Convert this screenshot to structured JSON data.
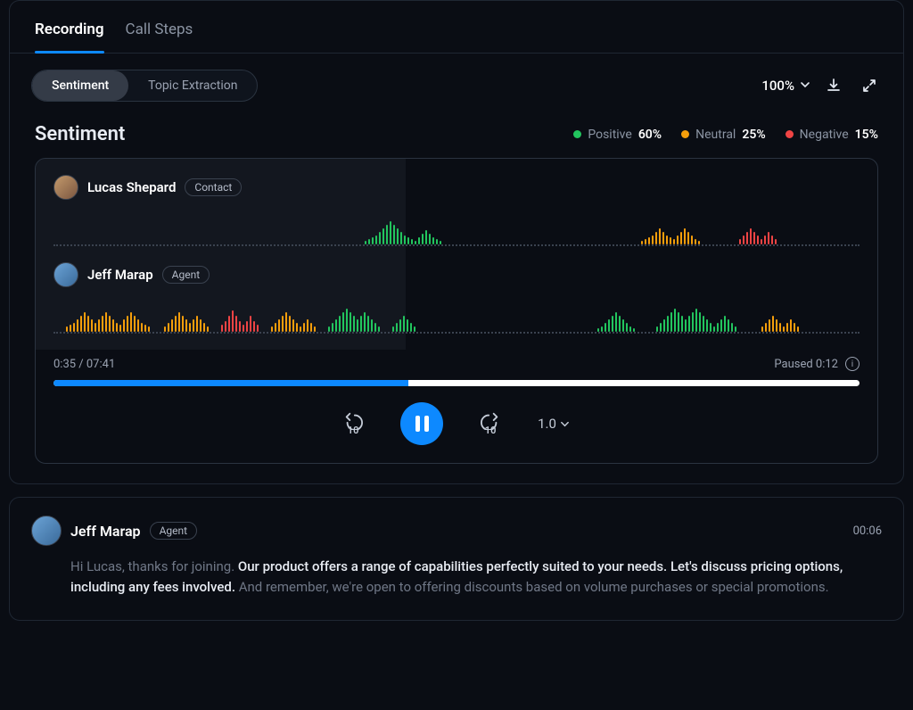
{
  "tabs": {
    "recording": "Recording",
    "call_steps": "Call Steps"
  },
  "toolbar": {
    "sentiment": "Sentiment",
    "topic_extraction": "Topic Extraction",
    "zoom": "100%"
  },
  "section": {
    "title": "Sentiment",
    "legend": {
      "positive_label": "Positive",
      "positive_val": "60%",
      "neutral_label": "Neutral",
      "neutral_val": "25%",
      "negative_label": "Negative",
      "negative_val": "15%"
    }
  },
  "colors": {
    "positive": "#22c55e",
    "neutral": "#f59e0b",
    "negative": "#ef4444",
    "accent": "#0d89ff"
  },
  "tracks": [
    {
      "name": "Lucas Shepard",
      "role": "Contact",
      "segments": [
        {
          "gap": 345
        },
        {
          "color": "green",
          "bars": [
            4,
            6,
            8,
            10,
            14,
            18,
            22,
            26,
            22,
            18,
            14,
            10,
            8,
            6,
            4,
            8,
            12,
            16,
            12,
            8,
            6,
            4
          ]
        },
        {
          "gap": 220
        },
        {
          "color": "orange",
          "bars": [
            4,
            6,
            8,
            10,
            14,
            18,
            14,
            10,
            8,
            6,
            10,
            14,
            18,
            14,
            10,
            6,
            4
          ]
        },
        {
          "gap": 40
        },
        {
          "color": "red",
          "bars": [
            6,
            10,
            14,
            18,
            14,
            10,
            6,
            10,
            14,
            10,
            6
          ]
        },
        {
          "gap": 999
        }
      ]
    },
    {
      "name": "Jeff Marap",
      "role": "Agent",
      "segments": [
        {
          "gap": 10
        },
        {
          "color": "orange",
          "bars": [
            6,
            8,
            10,
            14,
            18,
            22,
            18,
            14,
            10,
            14,
            18,
            22,
            18,
            14,
            10,
            8,
            14,
            18,
            22,
            18,
            14,
            10,
            8,
            6
          ]
        },
        {
          "gap": 12
        },
        {
          "color": "orange",
          "bars": [
            6,
            10,
            14,
            18,
            22,
            18,
            14,
            10,
            14,
            18,
            14,
            10,
            6
          ]
        },
        {
          "gap": 10
        },
        {
          "color": "red",
          "bars": [
            8,
            12,
            18,
            24,
            18,
            12,
            8,
            12,
            18,
            12,
            8
          ]
        },
        {
          "gap": 10
        },
        {
          "color": "orange",
          "bars": [
            6,
            10,
            14,
            18,
            22,
            18,
            14,
            10,
            6,
            10,
            14,
            10,
            6
          ]
        },
        {
          "gap": 10
        },
        {
          "color": "green",
          "bars": [
            6,
            10,
            14,
            18,
            22,
            26,
            22,
            18,
            14,
            18,
            22,
            18,
            14,
            10,
            6
          ]
        },
        {
          "gap": 10
        },
        {
          "color": "green",
          "bars": [
            6,
            10,
            14,
            18,
            14,
            10,
            6
          ]
        },
        {
          "gap": 200
        },
        {
          "color": "green",
          "bars": [
            4,
            6,
            10,
            14,
            18,
            22,
            18,
            14,
            10,
            6,
            4
          ]
        },
        {
          "gap": 20
        },
        {
          "color": "green",
          "bars": [
            6,
            10,
            14,
            18,
            22,
            26,
            22,
            18,
            14,
            18,
            22,
            26,
            22,
            18,
            14,
            10,
            6,
            10,
            14,
            18,
            14,
            10,
            6
          ]
        },
        {
          "gap": 24
        },
        {
          "color": "orange",
          "bars": [
            6,
            10,
            14,
            18,
            14,
            10,
            6,
            10,
            14,
            10,
            6
          ]
        },
        {
          "gap": 999
        }
      ]
    }
  ],
  "time": {
    "elapsed_total": "0:35 / 07:41",
    "paused": "Paused 0:12"
  },
  "controls": {
    "skip_back": "10",
    "skip_fwd": "10",
    "speed": "1.0"
  },
  "transcript": {
    "speaker": "Jeff Marap",
    "role": "Agent",
    "timestamp": "00:06",
    "seg1": "Hi Lucas, thanks for joining. ",
    "seg2": "Our product offers a range of capabilities perfectly suited to your needs. Let's discuss pricing options, including any fees involved.",
    "seg3": " And remember, we're open to offering discounts based on volume purchases or special promotions."
  }
}
